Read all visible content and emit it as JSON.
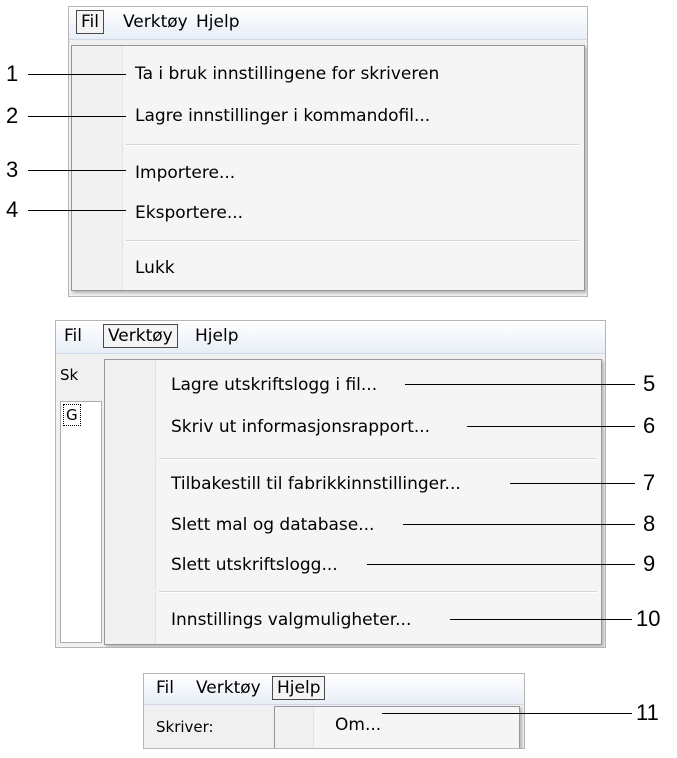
{
  "panel1": {
    "menubar": [
      "Fil",
      "Verktøy",
      "Hjelp"
    ],
    "items": [
      "Ta i bruk innstillingene for skriveren",
      "Lagre innstillinger i kommandofil...",
      "Importere...",
      "Eksportere...",
      "Lukk"
    ]
  },
  "panel2": {
    "menubar": [
      "Fil",
      "Verktøy",
      "Hjelp"
    ],
    "bg_label": "Sk",
    "bg_box": "G",
    "items": [
      "Lagre utskriftslogg i fil...",
      "Skriv ut informasjonsrapport...",
      "Tilbakestill til fabrikkinnstillinger...",
      "Slett mal og database...",
      "Slett utskriftslogg...",
      "Innstillings valgmuligheter..."
    ]
  },
  "panel3": {
    "menubar": [
      "Fil",
      "Verktøy",
      "Hjelp"
    ],
    "bg_label": "Skriver:",
    "items": [
      "Om..."
    ]
  },
  "callouts": [
    "1",
    "2",
    "3",
    "4",
    "5",
    "6",
    "7",
    "8",
    "9",
    "10",
    "11"
  ]
}
